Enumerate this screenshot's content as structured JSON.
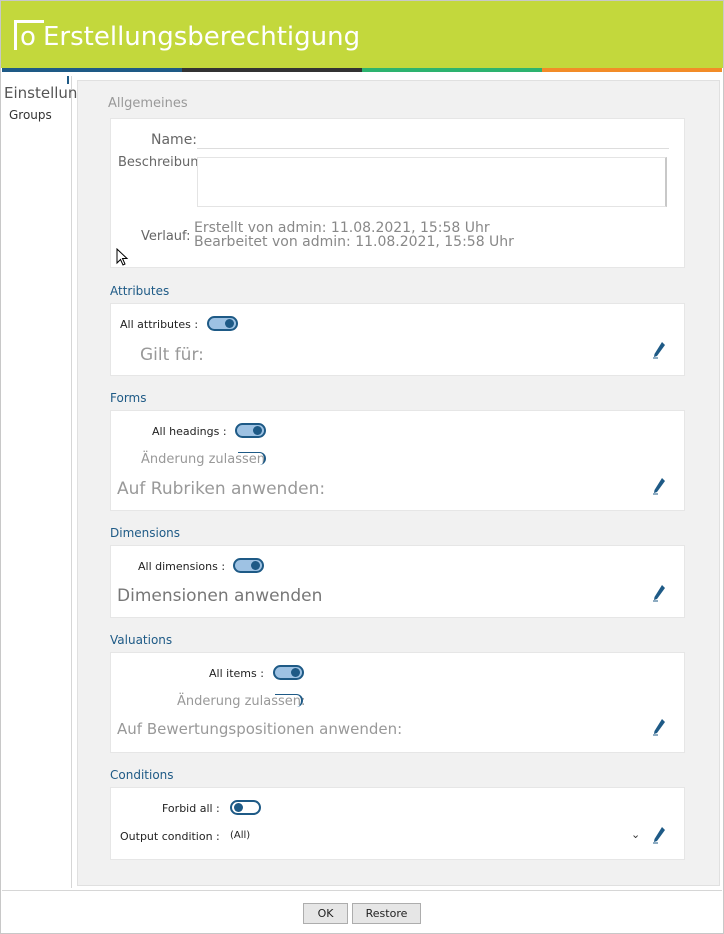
{
  "window": {
    "title": "Erstellungsberechtigung"
  },
  "header_colors": {
    "bar": "#c3d83c",
    "stripes": [
      "#1e5a86",
      "#333333",
      "#2db36f",
      "#f28c28"
    ]
  },
  "sidebar": {
    "title": "Einstellungen",
    "items": [
      {
        "label": "Groups"
      }
    ]
  },
  "general": {
    "title": "Allgemeines",
    "name_label": "Name:",
    "description_label": "Beschreibung:",
    "history_label": "Verlauf:",
    "created": "Erstellt von admin: 11.08.2021, 15:58 Uhr",
    "edited": "Bearbeitet von admin: 11.08.2021, 15:58 Uhr"
  },
  "attributes": {
    "title": "Attributes",
    "toggle_label": "All attributes :",
    "toggle_on": true,
    "applies_label": "Gilt für:",
    "edit_icon": "pencil-icon"
  },
  "forms": {
    "title": "Forms",
    "toggle_label": "All headings :",
    "toggle_on": true,
    "allow_change_label": "Änderung zulassen",
    "apply_label": "Auf Rubriken anwenden:",
    "edit_icon": "pencil-icon"
  },
  "dimensions": {
    "title": "Dimensions",
    "toggle_label": "All dimensions :",
    "toggle_on": true,
    "apply_label": "Dimensionen anwenden",
    "edit_icon": "pencil-icon"
  },
  "valuations": {
    "title": "Valuations",
    "toggle_label": "All items :",
    "toggle_on": true,
    "allow_change_label": "Änderung zulassen:",
    "apply_label": "Auf Bewertungspositionen anwenden:",
    "edit_icon": "pencil-icon"
  },
  "conditions": {
    "title": "Conditions",
    "forbid_label": "Forbid all :",
    "forbid_on": false,
    "output_label": "Output condition :",
    "output_value": "(All)",
    "edit_icon": "pencil-icon"
  },
  "footer": {
    "ok_label": "OK",
    "restore_label": "Restore"
  }
}
